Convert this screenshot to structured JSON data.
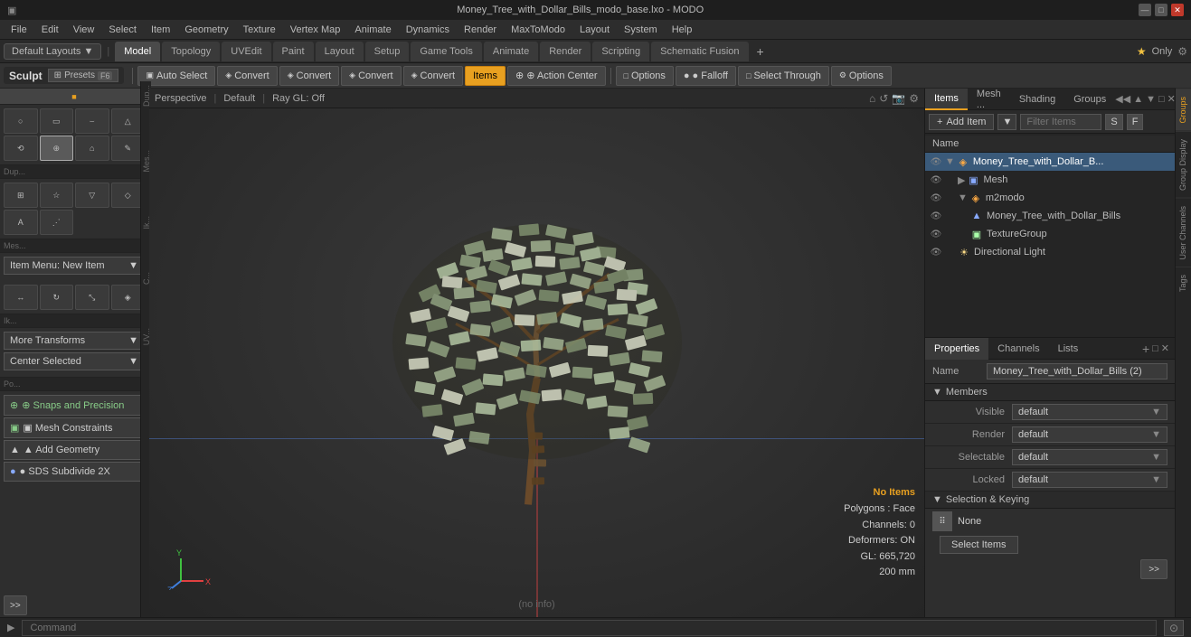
{
  "titlebar": {
    "title": "Money_Tree_with_Dollar_Bills_modo_base.lxo - MODO",
    "min_btn": "—",
    "max_btn": "□",
    "close_btn": "✕"
  },
  "menubar": {
    "items": [
      "File",
      "Edit",
      "View",
      "Select",
      "Item",
      "Geometry",
      "Texture",
      "Vertex Map",
      "Animate",
      "Dynamics",
      "Render",
      "MaxToModo",
      "Layout",
      "System",
      "Help"
    ]
  },
  "layouts": {
    "label": "Default Layouts",
    "arrow": "▼"
  },
  "tabs": {
    "items": [
      "Model",
      "Topology",
      "UVEdit",
      "Paint",
      "Layout",
      "Setup",
      "Game Tools",
      "Animate",
      "Render",
      "Scripting",
      "Schematic Fusion"
    ],
    "active": "Model",
    "plus": "+"
  },
  "toolbar": {
    "sculpt_label": "Sculpt",
    "presets_label": "⊞ Presets",
    "presets_key": "F6",
    "auto_select": "Auto Select",
    "convert1": "Convert",
    "convert2": "Convert",
    "convert3": "Convert",
    "convert4": "Convert",
    "items_label": "Items",
    "action_center": "⊕ Action Center",
    "options1": "Options",
    "falloff": "● Falloff",
    "options2": "Options",
    "select_through": "Select Through"
  },
  "viewport": {
    "perspective_label": "Perspective",
    "default_label": "Default",
    "raygl_label": "Ray GL: Off",
    "hud": {
      "no_items": "No Items",
      "polygons": "Polygons : Face",
      "channels": "Channels: 0",
      "deformers": "Deformers: ON",
      "gl": "GL: 665,720",
      "size": "200 mm"
    },
    "bottom_info": "(no info)"
  },
  "left_panel": {
    "sculpt": "Sculpt",
    "presets": "Presets",
    "presets_key": "F6",
    "tools": [
      {
        "icon": "○",
        "label": "sphere"
      },
      {
        "icon": "▭",
        "label": "box"
      },
      {
        "icon": "⌣",
        "label": "cylinder"
      },
      {
        "icon": "△",
        "label": "cone"
      },
      {
        "icon": "⟲",
        "label": "rotate-x"
      },
      {
        "icon": "⊕",
        "label": "join"
      },
      {
        "icon": "⌂",
        "label": "surface"
      },
      {
        "icon": "✎",
        "label": "pen"
      },
      {
        "icon": "⊞",
        "label": "grid"
      },
      {
        "icon": "☆",
        "label": "star"
      },
      {
        "icon": "▽",
        "label": "tri"
      },
      {
        "icon": "◇",
        "label": "diamond"
      },
      {
        "icon": "A",
        "label": "text"
      },
      {
        "icon": "⋰",
        "label": "dots"
      }
    ],
    "item_menu": "Item Menu: New Item",
    "transforms": [
      {
        "icon": "↔",
        "label": "move"
      },
      {
        "icon": "↻",
        "label": "rotate"
      },
      {
        "icon": "⤡",
        "label": "scale"
      },
      {
        "icon": "◈",
        "label": "transform"
      }
    ],
    "more_transforms": "More Transforms",
    "center_selected": "Center Selected",
    "snaps_label": "⊕ Snaps and Precision",
    "mesh_constraints": "▣ Mesh Constraints",
    "add_geometry": "▲ Add Geometry",
    "sds_label": "● SDS Subdivide 2X",
    "expand_btn": ">>"
  },
  "right_panel": {
    "tabs": [
      "Items",
      "Mesh ...",
      "Shading",
      "Groups"
    ],
    "active_tab": "Items",
    "tab_controls": [
      "◀◀",
      "▲",
      "▼",
      "□",
      "✕"
    ],
    "items_toolbar": {
      "add_item": "Add Item",
      "dropdown_arrow": "▼",
      "filter_placeholder": "Filter Items",
      "s_btn": "S",
      "f_btn": "F"
    },
    "tree_header": "Name",
    "tree_items": [
      {
        "level": 0,
        "icon": "group",
        "label": "Money_Tree_with_Dollar_B...",
        "expanded": true,
        "visible": true,
        "selected": true
      },
      {
        "level": 1,
        "icon": "mesh",
        "label": "Mesh",
        "expanded": false,
        "visible": true,
        "selected": false
      },
      {
        "level": 1,
        "icon": "group",
        "label": "m2modo",
        "expanded": true,
        "visible": true,
        "selected": false
      },
      {
        "level": 2,
        "icon": "mesh",
        "label": "Money_Tree_with_Dollar_Bills",
        "expanded": false,
        "visible": true,
        "selected": false
      },
      {
        "level": 2,
        "icon": "texture",
        "label": "TextureGroup",
        "expanded": false,
        "visible": true,
        "selected": false
      },
      {
        "level": 1,
        "icon": "light",
        "label": "Directional Light",
        "expanded": false,
        "visible": true,
        "selected": false
      }
    ]
  },
  "properties": {
    "tabs": [
      "Properties",
      "Channels",
      "Lists"
    ],
    "active_tab": "Properties",
    "plus_btn": "+",
    "name_label": "Name",
    "name_value": "Money_Tree_with_Dollar_Bills (2)",
    "members_label": "Members",
    "rows": [
      {
        "label": "Visible",
        "value": "default"
      },
      {
        "label": "Render",
        "value": "default"
      },
      {
        "label": "Selectable",
        "value": "default"
      },
      {
        "label": "Locked",
        "value": "default"
      }
    ],
    "selection_keying": "Selection & Keying",
    "none_icon": "⠿",
    "none_label": "None",
    "select_items_btn": "Select Items",
    "expand_btn": ">>"
  },
  "groups_tabs": [
    "Groups",
    "Group Display",
    "User Channels",
    "Tags"
  ],
  "bottom_bar": {
    "arrow": "▶",
    "command_placeholder": "Command",
    "go_btn": "⊙"
  }
}
